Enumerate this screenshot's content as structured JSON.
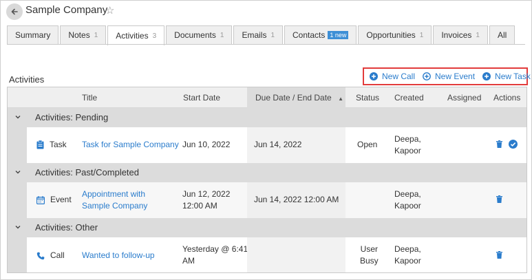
{
  "header": {
    "title": "Sample Company"
  },
  "tabs": [
    {
      "label": "Summary",
      "count": "",
      "badge": ""
    },
    {
      "label": "Notes",
      "count": "1",
      "badge": ""
    },
    {
      "label": "Activities",
      "count": "3",
      "badge": ""
    },
    {
      "label": "Documents",
      "count": "1",
      "badge": ""
    },
    {
      "label": "Emails",
      "count": "1",
      "badge": ""
    },
    {
      "label": "Contacts",
      "count": "",
      "badge": "1 new"
    },
    {
      "label": "Opportunities",
      "count": "1",
      "badge": ""
    },
    {
      "label": "Invoices",
      "count": "1",
      "badge": ""
    },
    {
      "label": "All",
      "count": "",
      "badge": ""
    }
  ],
  "active_tab": "Activities",
  "section": {
    "title": "Activities",
    "new_call": "New Call",
    "new_event": "New Event",
    "new_task": "New Task"
  },
  "columns": {
    "title": "Title",
    "start_date": "Start Date",
    "due_date": "Due Date / End Date",
    "status": "Status",
    "created": "Created",
    "assigned": "Assigned",
    "actions": "Actions"
  },
  "groups": [
    {
      "label": "Activities: Pending",
      "row": {
        "type": "Task",
        "title_line1": "Task for Sample Company",
        "title_line2": "",
        "start_line1": "Jun 10, 2022",
        "start_line2": "",
        "due": "Jun 14, 2022",
        "status_line1": "Open",
        "status_line2": "",
        "created_line1": "Deepa,",
        "created_line2": "Kapoor"
      }
    },
    {
      "label": "Activities: Past/Completed",
      "row": {
        "type": "Event",
        "title_line1": "Appointment with",
        "title_line2": "Sample Company",
        "start_line1": "Jun 12, 2022",
        "start_line2": "12:00 AM",
        "due": "Jun 14, 2022 12:00 AM",
        "status_line1": "",
        "status_line2": "",
        "created_line1": "Deepa,",
        "created_line2": "Kapoor"
      }
    },
    {
      "label": "Activities: Other",
      "row": {
        "type": "Call",
        "title_line1": "Wanted to follow-up",
        "title_line2": "",
        "start_line1": "Yesterday @ 6:41",
        "start_line2": "AM",
        "due": "",
        "status_line1": "User",
        "status_line2": "Busy",
        "created_line1": "Deepa,",
        "created_line2": "Kapoor"
      }
    }
  ],
  "colors": {
    "accent": "#2a7ccc",
    "highlight_border": "#e23b3b",
    "badge": "#3d8fd6"
  }
}
